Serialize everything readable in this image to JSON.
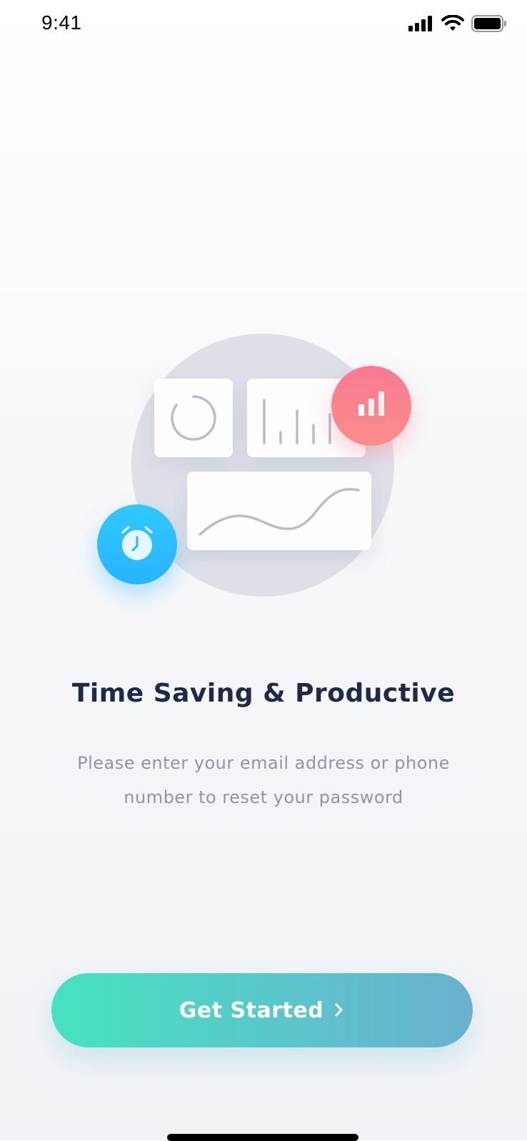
{
  "status_bar": {
    "time": "9:41",
    "icons": [
      "cellular-signal-icon",
      "wifi-icon",
      "battery-icon"
    ]
  },
  "illustration": {
    "icons": [
      "progress-ring-icon",
      "bar-chart-lines-icon",
      "wave-line-icon",
      "bar-chart-icon",
      "alarm-clock-icon"
    ],
    "colors": {
      "chart_badge": "#f87a93",
      "clock_badge": "#29b3ff",
      "backdrop": "#dee0e8",
      "line_gray": "#b7bccd"
    }
  },
  "onboarding": {
    "title": "Time Saving & Productive",
    "description": "Please enter your email address or phone number to reset your password"
  },
  "cta": {
    "label": "Get Started",
    "icon": "chevron-right-icon",
    "gradient": [
      "#45e3c0",
      "#6ab0ce"
    ]
  }
}
